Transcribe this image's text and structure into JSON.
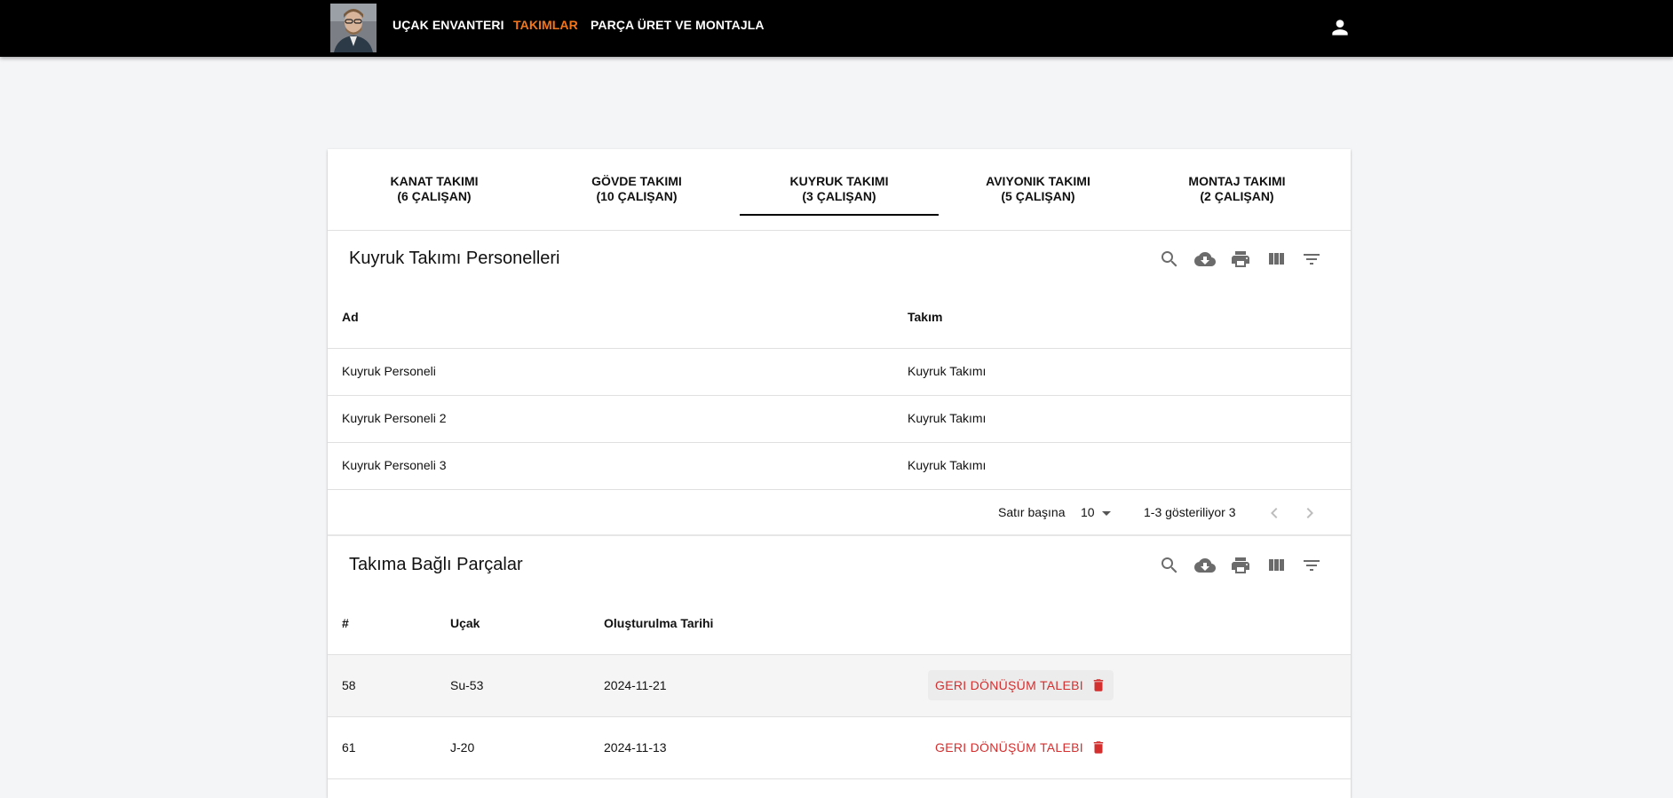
{
  "nav": {
    "items": [
      "UÇAK ENVANTERI",
      "TAKIMLAR",
      "PARÇA ÜRET VE MONTAJLA"
    ],
    "active": "TAKIMLAR",
    "avatar_icon": "user-photo",
    "user_icon": "account-icon",
    "accent_color": "#f5761a"
  },
  "tabs": [
    {
      "label": "KANAT TAKIMI",
      "count": "(6 ÇALIŞAN)"
    },
    {
      "label": "GÖVDE TAKIMI",
      "count": "(10 ÇALIŞAN)"
    },
    {
      "label": "KUYRUK TAKIMI",
      "count": "(3 ÇALIŞAN)"
    },
    {
      "label": "AVIYONIK TAKIMI",
      "count": "(5 ÇALIŞAN)"
    },
    {
      "label": "MONTAJ TAKIMI",
      "count": "(2 ÇALIŞAN)"
    }
  ],
  "active_tab": "KUYRUK TAKIMI",
  "personnel": {
    "title": "Kuyruk Takımı Personelleri",
    "columns": [
      "Ad",
      "Takım"
    ],
    "rows": [
      [
        "Kuyruk Personeli",
        "Kuyruk Takımı"
      ],
      [
        "Kuyruk Personeli 2",
        "Kuyruk Takımı"
      ],
      [
        "Kuyruk Personeli 3",
        "Kuyruk Takımı"
      ]
    ],
    "pagination": {
      "rows_per_page_label": "Satır başına",
      "rows_per_page": "10",
      "range_text": "1-3 gösteriliyor 3"
    }
  },
  "parts": {
    "title": "Takıma Bağlı Parçalar",
    "columns": [
      "#",
      "Uçak",
      "Oluşturulma Tarihi"
    ],
    "rows": [
      {
        "id": "58",
        "plane": "Su-53",
        "date": "2024-11-21",
        "action": "GERI DÖNÜŞÜM TALEBI"
      },
      {
        "id": "61",
        "plane": "J-20",
        "date": "2024-11-13",
        "action": "GERI DÖNÜŞÜM TALEBI"
      }
    ],
    "action_color": "#d32f2f"
  },
  "toolbar_icons": [
    "search-icon",
    "download-icon",
    "print-icon",
    "columns-icon",
    "filter-icon"
  ]
}
